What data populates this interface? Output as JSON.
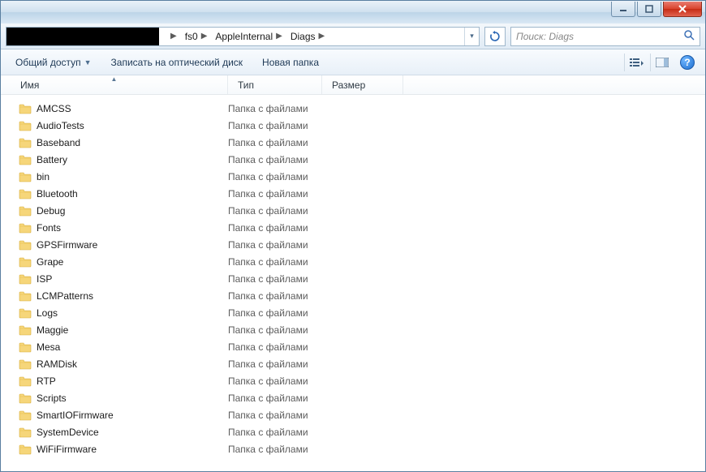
{
  "breadcrumbs": [
    "fs0",
    "AppleInternal",
    "Diags"
  ],
  "search": {
    "placeholder": "Поиск: Diags"
  },
  "toolbar": {
    "share": "Общий доступ",
    "burn": "Записать на оптический диск",
    "new_folder": "Новая папка"
  },
  "columns": {
    "name": "Имя",
    "type": "Тип",
    "size": "Размер"
  },
  "type_label": "Папка с файлами",
  "items": [
    {
      "name": "AMCSS"
    },
    {
      "name": "AudioTests"
    },
    {
      "name": "Baseband"
    },
    {
      "name": "Battery"
    },
    {
      "name": "bin"
    },
    {
      "name": "Bluetooth"
    },
    {
      "name": "Debug"
    },
    {
      "name": "Fonts"
    },
    {
      "name": "GPSFirmware"
    },
    {
      "name": "Grape"
    },
    {
      "name": "ISP"
    },
    {
      "name": "LCMPatterns"
    },
    {
      "name": "Logs"
    },
    {
      "name": "Maggie"
    },
    {
      "name": "Mesa"
    },
    {
      "name": "RAMDisk"
    },
    {
      "name": "RTP"
    },
    {
      "name": "Scripts"
    },
    {
      "name": "SmartIOFirmware"
    },
    {
      "name": "SystemDevice"
    },
    {
      "name": "WiFiFirmware"
    }
  ]
}
